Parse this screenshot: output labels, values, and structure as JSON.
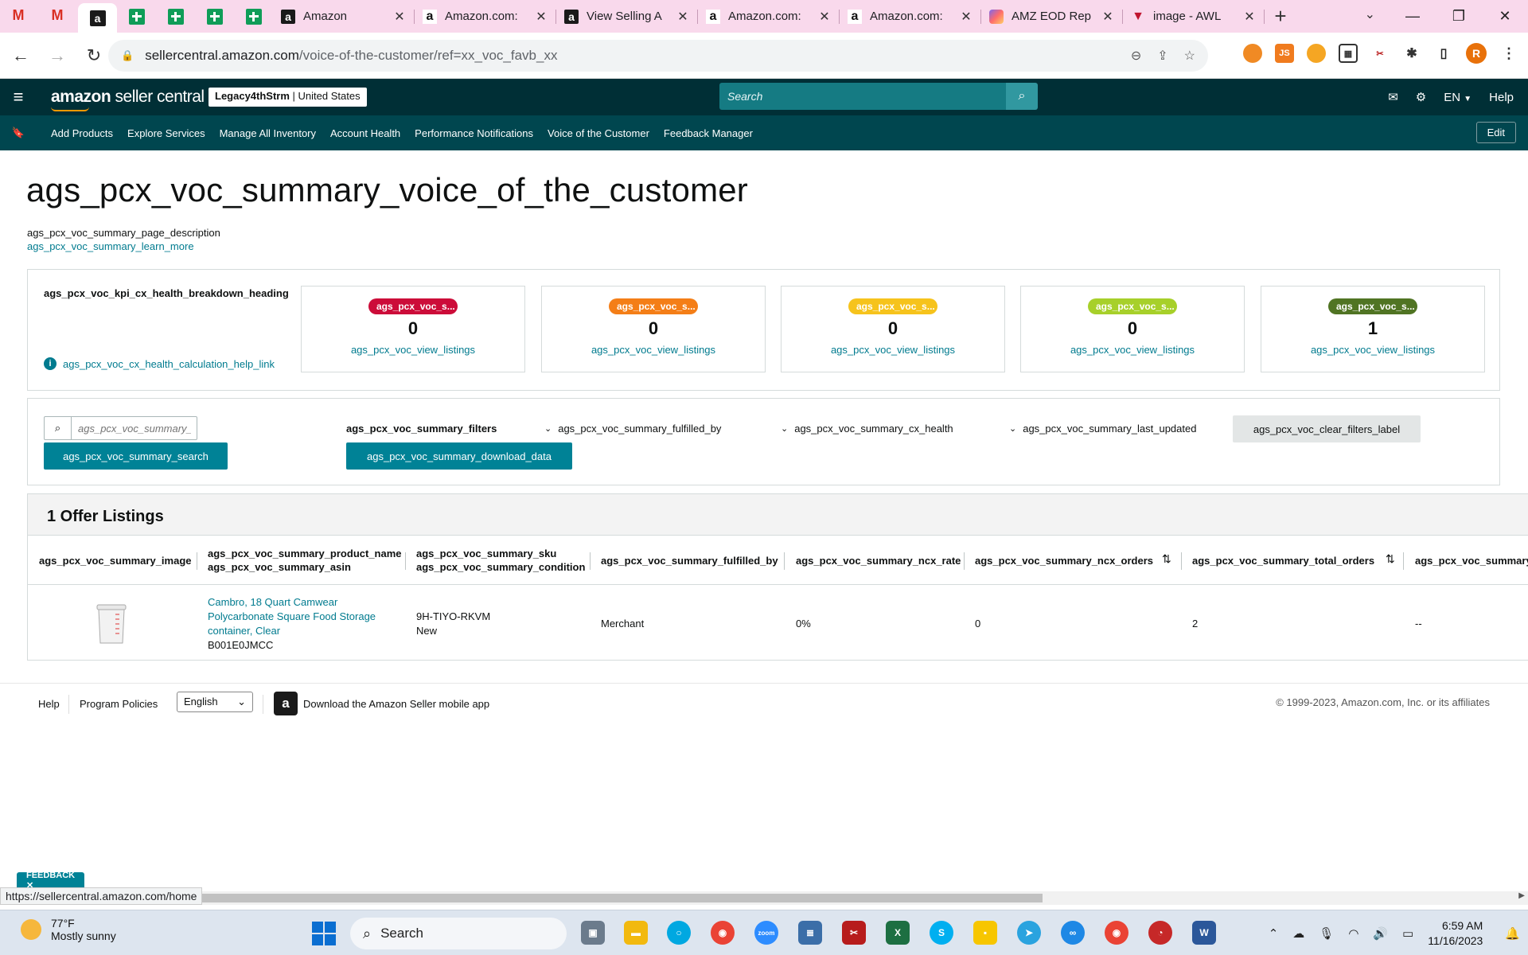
{
  "browser": {
    "tabs": [
      {
        "title": "Amazon",
        "favicon": "amazon-icon"
      },
      {
        "title": "Amazon.com:",
        "favicon": "amazon-icon"
      },
      {
        "title": "View Selling A",
        "favicon": "amazon-icon"
      },
      {
        "title": "Amazon.com:",
        "favicon": "amazon-icon"
      },
      {
        "title": "Amazon.com:",
        "favicon": "amazon-icon"
      },
      {
        "title": "AMZ EOD Rep",
        "favicon": "clickup-icon"
      },
      {
        "title": "image - AWL",
        "favicon": "awl-icon"
      }
    ],
    "url_host": "sellercentral.amazon.com",
    "url_path": "/voice-of-the-customer/ref=xx_voc_favb_xx",
    "profile_initial": "R",
    "status_url": "https://sellercentral.amazon.com/home"
  },
  "header": {
    "logo_brand": "amazon",
    "logo_product": " seller central",
    "store_name": "Legacy4thStrm",
    "store_region": " | United States",
    "search_placeholder": "Search",
    "language": "EN",
    "help": "Help"
  },
  "nav": {
    "items": [
      "Add Products",
      "Explore Services",
      "Manage All Inventory",
      "Account Health",
      "Performance Notifications",
      "Voice of the Customer",
      "Feedback Manager"
    ],
    "edit_label": "Edit"
  },
  "page": {
    "title": "ags_pcx_voc_summary_voice_of_the_customer",
    "description": "ags_pcx_voc_summary_page_description",
    "learn_more": "ags_pcx_voc_summary_learn_more"
  },
  "kpi": {
    "heading": "ags_pcx_voc_kpi_cx_health_breakdown_heading",
    "help_link": "ags_pcx_voc_cx_health_calculation_help_link",
    "cards": [
      {
        "pill": "ags_pcx_voc_s...",
        "color": "#cc0c39",
        "value": "0",
        "link": "ags_pcx_voc_view_listings"
      },
      {
        "pill": "ags_pcx_voc_s...",
        "color": "#f47e17",
        "value": "0",
        "link": "ags_pcx_voc_view_listings"
      },
      {
        "pill": "ags_pcx_voc_s...",
        "color": "#f6c31c",
        "value": "0",
        "link": "ags_pcx_voc_view_listings"
      },
      {
        "pill": "ags_pcx_voc_s...",
        "color": "#a7d02a",
        "value": "0",
        "link": "ags_pcx_voc_view_listings"
      },
      {
        "pill": "ags_pcx_voc_s...",
        "color": "#507423",
        "value": "1",
        "link": "ags_pcx_voc_view_listings"
      }
    ]
  },
  "filters": {
    "search_placeholder": "ags_pcx_voc_summary_",
    "search_button": "ags_pcx_voc_summary_search",
    "filters_label": "ags_pcx_voc_summary_filters",
    "download_button": "ags_pcx_voc_summary_download_data",
    "dropdowns": [
      "ags_pcx_voc_summary_fulfilled_by",
      "ags_pcx_voc_summary_cx_health",
      "ags_pcx_voc_summary_last_updated"
    ],
    "clear_button": "ags_pcx_voc_clear_filters_label"
  },
  "listings": {
    "heading": "1 Offer Listings",
    "columns": {
      "image": "ags_pcx_voc_summary_image",
      "product_name": "ags_pcx_voc_summary_product_name",
      "asin": "ags_pcx_voc_summary_asin",
      "sku": "ags_pcx_voc_summary_sku",
      "condition": "ags_pcx_voc_summary_condition",
      "fulfilled_by": "ags_pcx_voc_summary_fulfilled_by",
      "ncx_rate": "ags_pcx_voc_summary_ncx_rate",
      "ncx_orders": "ags_pcx_voc_summary_ncx_orders",
      "total_orders": "ags_pcx_voc_summary_total_orders",
      "last": "ags_pcx_voc_summary_"
    },
    "rows": [
      {
        "product_name_l1": "Cambro, 18 Quart Camwear",
        "product_name_l2": "Polycarbonate Square Food Storage",
        "product_name_l3": "container, Clear",
        "asin": "B001E0JMCC",
        "sku": "9H-TIYO-RKVM",
        "condition": "New",
        "fulfilled_by": "Merchant",
        "ncx_rate": "0%",
        "ncx_orders": "0",
        "total_orders": "2",
        "last": "--"
      }
    ]
  },
  "footer": {
    "help": "Help",
    "policies": "Program Policies",
    "language": "English",
    "app": "Download the Amazon Seller mobile app",
    "copyright": "© 1999-2023, Amazon.com, Inc. or its affiliates",
    "feedback": "FEEDBACK ✕"
  },
  "taskbar": {
    "temp": "77°F",
    "weather": "Mostly sunny",
    "search": "Search",
    "time": "6:59 AM",
    "date": "11/16/2023"
  }
}
